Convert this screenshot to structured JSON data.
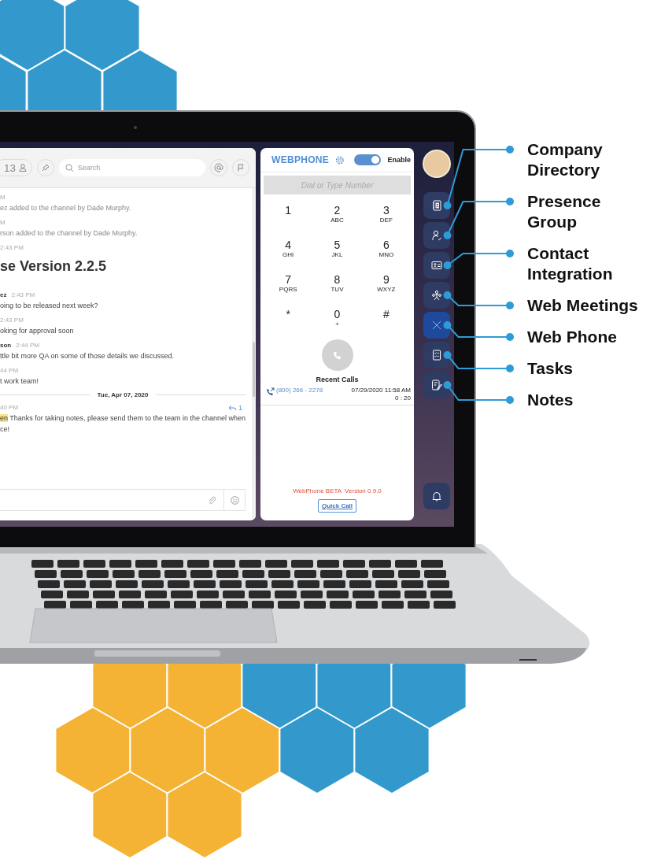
{
  "chat": {
    "member_count": "13",
    "search": {
      "placeholder": "Search"
    },
    "messages": [
      {
        "kind": "system",
        "time": "M",
        "text": "ez added to the channel by Dade Murphy."
      },
      {
        "kind": "system",
        "time": "M",
        "text": "rson added to the channel by Dade Murphy."
      },
      {
        "kind": "heading",
        "time": "2:43 PM",
        "text": "se Version 2.2.5"
      },
      {
        "kind": "message",
        "name": "ez",
        "time": "2:43 PM",
        "text": "oing to be released next week?"
      },
      {
        "kind": "message",
        "time": "2:43 PM",
        "text": "oking for approval soon"
      },
      {
        "kind": "message",
        "name": "son",
        "time": "2:44 PM",
        "text": "ttle bit more QA on some of those details we discussed."
      },
      {
        "kind": "message",
        "time": "44 PM",
        "text": "t work team!"
      },
      {
        "kind": "divider",
        "text": "Tue, Apr 07, 2020"
      },
      {
        "kind": "mention",
        "time": "40 PM",
        "replies": "1",
        "mention": "en",
        "text": "Thanks for taking notes, please send them to the team in the channel when",
        "more": "ce!"
      }
    ]
  },
  "phone": {
    "title": "WEBPHONE",
    "toggle": {
      "on": true,
      "label": "Enable"
    },
    "dial": {
      "placeholder": "Dial or Type Number"
    },
    "keys": [
      {
        "digit": "1"
      },
      {
        "digit": "2",
        "letters": "ABC"
      },
      {
        "digit": "3",
        "letters": "DEF"
      },
      {
        "digit": "4",
        "letters": "GHI"
      },
      {
        "digit": "5",
        "letters": "JKL"
      },
      {
        "digit": "6",
        "letters": "MNO"
      },
      {
        "digit": "7",
        "letters": "PQRS"
      },
      {
        "digit": "8",
        "letters": "TUV"
      },
      {
        "digit": "9",
        "letters": "WXYZ"
      },
      {
        "digit": "*"
      },
      {
        "digit": "0",
        "letters": "+"
      },
      {
        "digit": "#"
      }
    ],
    "recent_title": "Recent Calls",
    "recent_calls": [
      {
        "number": "(800) 266 - 2278",
        "date": "07/29/2020 11:58 AM",
        "duration": "0 : 20"
      }
    ],
    "version": "WebPhone BETA  Version 0.9.0",
    "quick_call": "Quick Call"
  },
  "rail": {
    "items": [
      {
        "kind": "directory",
        "selected": false
      },
      {
        "kind": "presence",
        "selected": false
      },
      {
        "kind": "contact",
        "selected": false
      },
      {
        "kind": "meetings",
        "selected": false
      },
      {
        "kind": "phone",
        "selected": true
      },
      {
        "kind": "tasks",
        "selected": false
      },
      {
        "kind": "notes",
        "selected": false
      }
    ]
  },
  "callouts": [
    {
      "lines": [
        "Company",
        "Directory"
      ]
    },
    {
      "lines": [
        "Presence",
        "Group"
      ]
    },
    {
      "lines": [
        "Contact",
        "Integration"
      ]
    },
    {
      "lines": [
        "Web Meetings"
      ]
    },
    {
      "lines": [
        "Web Phone"
      ]
    },
    {
      "lines": [
        "Tasks"
      ]
    },
    {
      "lines": [
        "Notes"
      ]
    }
  ]
}
